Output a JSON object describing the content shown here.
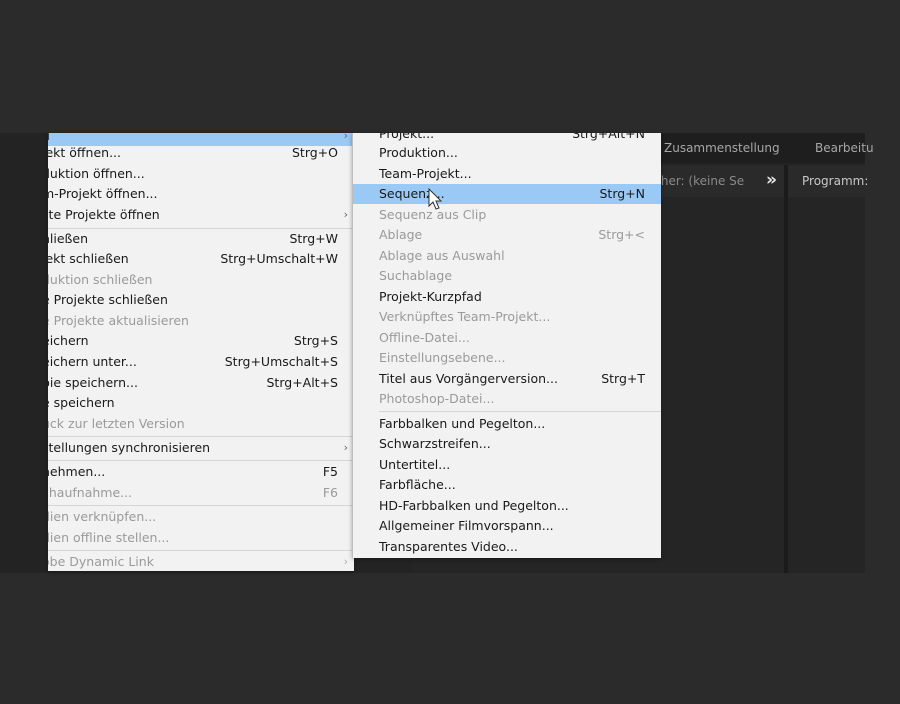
{
  "workspace": {
    "tab_assembly": "Zusammenstellung",
    "tab_edit": "Bearbeitu",
    "source_panel_title": "scher: (keine Se",
    "program_panel_title": "Programm:",
    "expand_glyph": "»"
  },
  "file_menu": {
    "items": [
      {
        "label": "u",
        "shortcut": "",
        "submenu": true,
        "disabled": false,
        "highlighted": true
      },
      {
        "label": "jekt öffnen...",
        "shortcut": "Strg+O",
        "submenu": false,
        "disabled": false
      },
      {
        "label": "duktion öffnen...",
        "shortcut": "",
        "submenu": false,
        "disabled": false
      },
      {
        "label": "m-Projekt öffnen...",
        "shortcut": "",
        "submenu": false,
        "disabled": false
      },
      {
        "label": "zte Projekte öffnen",
        "shortcut": "",
        "submenu": true,
        "disabled": false
      },
      {
        "label": "hließen",
        "shortcut": "Strg+W",
        "submenu": false,
        "disabled": false
      },
      {
        "label": "jekt schließen",
        "shortcut": "Strg+Umschalt+W",
        "submenu": false,
        "disabled": false
      },
      {
        "label": "duktion schließen",
        "shortcut": "",
        "submenu": false,
        "disabled": true
      },
      {
        "label": "e Projekte schließen",
        "shortcut": "",
        "submenu": false,
        "disabled": false
      },
      {
        "label": "e Projekte aktualisieren",
        "shortcut": "",
        "submenu": false,
        "disabled": true
      },
      {
        "label": "eichern",
        "shortcut": "Strg+S",
        "submenu": false,
        "disabled": false
      },
      {
        "label": "eichern unter...",
        "shortcut": "Strg+Umschalt+S",
        "submenu": false,
        "disabled": false
      },
      {
        "label": "pie speichern...",
        "shortcut": "Strg+Alt+S",
        "submenu": false,
        "disabled": false
      },
      {
        "label": "e speichern",
        "shortcut": "",
        "submenu": false,
        "disabled": false
      },
      {
        "label": "ück zur letzten Version",
        "shortcut": "",
        "submenu": false,
        "disabled": true
      },
      {
        "label": "stellungen synchronisieren",
        "shortcut": "",
        "submenu": true,
        "disabled": false
      },
      {
        "label": "nehmen...",
        "shortcut": "F5",
        "submenu": false,
        "disabled": false
      },
      {
        "label": "chaufnahme...",
        "shortcut": "F6",
        "submenu": false,
        "disabled": true
      },
      {
        "label": "dien verknüpfen...",
        "shortcut": "",
        "submenu": false,
        "disabled": true
      },
      {
        "label": "dien offline stellen...",
        "shortcut": "",
        "submenu": false,
        "disabled": true
      },
      {
        "label": "obe Dynamic Link",
        "shortcut": "",
        "submenu": true,
        "disabled": true
      }
    ]
  },
  "new_submenu": {
    "items": [
      {
        "label": "Projekt...",
        "shortcut": "Strg+Alt+N",
        "disabled": false
      },
      {
        "label": "Produktion...",
        "shortcut": "",
        "disabled": false
      },
      {
        "label": "Team-Projekt...",
        "shortcut": "",
        "disabled": false
      },
      {
        "label": "Sequenz...",
        "shortcut": "Strg+N",
        "disabled": false,
        "highlighted": true
      },
      {
        "label": "Sequenz aus Clip",
        "shortcut": "",
        "disabled": true
      },
      {
        "label": "Ablage",
        "shortcut": "Strg+<",
        "disabled": true
      },
      {
        "label": "Ablage aus Auswahl",
        "shortcut": "",
        "disabled": true
      },
      {
        "label": "Suchablage",
        "shortcut": "",
        "disabled": true
      },
      {
        "label": "Projekt-Kurzpfad",
        "shortcut": "",
        "disabled": false
      },
      {
        "label": "Verknüpftes Team-Projekt...",
        "shortcut": "",
        "disabled": true
      },
      {
        "label": "Offline-Datei...",
        "shortcut": "",
        "disabled": true
      },
      {
        "label": "Einstellungsebene...",
        "shortcut": "",
        "disabled": true
      },
      {
        "label": "Titel aus Vorgängerversion...",
        "shortcut": "Strg+T",
        "disabled": false
      },
      {
        "label": "Photoshop-Datei...",
        "shortcut": "",
        "disabled": true
      },
      {
        "label": "Farbbalken und Pegelton...",
        "shortcut": "",
        "disabled": false
      },
      {
        "label": "Schwarzstreifen...",
        "shortcut": "",
        "disabled": false
      },
      {
        "label": "Untertitel...",
        "shortcut": "",
        "disabled": false
      },
      {
        "label": "Farbfläche...",
        "shortcut": "",
        "disabled": false
      },
      {
        "label": "HD-Farbbalken und Pegelton...",
        "shortcut": "",
        "disabled": false
      },
      {
        "label": "Allgemeiner Filmvorspann...",
        "shortcut": "",
        "disabled": false
      },
      {
        "label": "Transparentes Video...",
        "shortcut": "",
        "disabled": false
      }
    ]
  },
  "colors": {
    "menu_bg": "#f2f2f2",
    "highlight": "#99c9f4",
    "disabled_text": "#9a9a9a",
    "app_bg": "#232323"
  }
}
